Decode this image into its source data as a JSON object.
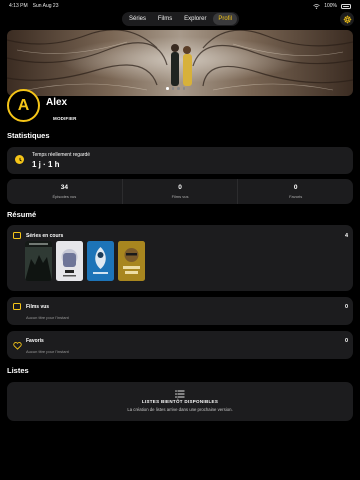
{
  "status_bar": {
    "time": "4:13 PM",
    "date": "Sun Aug 23",
    "battery": "100%"
  },
  "nav": {
    "tabs": [
      "Séries",
      "Films",
      "Explorer",
      "Profil"
    ],
    "active": "Profil"
  },
  "profile": {
    "initial": "A",
    "name": "Alex",
    "edit_label": "MODIFIER"
  },
  "sections": {
    "statistics": "Statistiques",
    "summary": "Résumé",
    "lists": "Listes"
  },
  "watched": {
    "label": "Temps réellement regardé",
    "value": "1 j · 1 h"
  },
  "stats": [
    {
      "value": "34",
      "label": "Épisodes vus"
    },
    {
      "value": "0",
      "label": "Films vus"
    },
    {
      "value": "0",
      "label": "Favoris"
    }
  ],
  "series_in_progress": {
    "title": "Séries en cours",
    "count": "4",
    "posters": [
      "gothic-drama",
      "The Bear",
      "Severance",
      "Breaking Bad"
    ]
  },
  "films_seen": {
    "title": "Films vus",
    "count": "0",
    "empty": "Aucun titre pour l'instant"
  },
  "favorites": {
    "title": "Favoris",
    "count": "0",
    "empty": "Aucun titre pour l'instant"
  },
  "lists": {
    "title": "LISTES BIENTÔT DISPONIBLES",
    "subtitle": "La création de listes arrive dans une prochaine version."
  },
  "colors": {
    "accent": "#f5c518",
    "card": "#1c1c1e",
    "background": "#000000"
  }
}
